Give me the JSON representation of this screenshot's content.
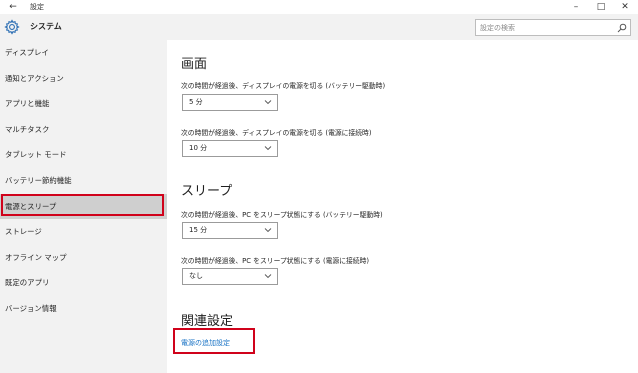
{
  "window": {
    "back_glyph": "←",
    "title": "設定",
    "minimize_glyph": "–",
    "maximize_glyph": "□",
    "close_glyph": "✕"
  },
  "header": {
    "icon": "gear-icon",
    "title": "システム",
    "search_placeholder": "設定の検索",
    "search_icon": "search-icon"
  },
  "sidebar": {
    "items": [
      {
        "label": "ディスプレイ",
        "active": false
      },
      {
        "label": "通知とアクション",
        "active": false
      },
      {
        "label": "アプリと機能",
        "active": false
      },
      {
        "label": "マルチタスク",
        "active": false
      },
      {
        "label": "タブレット モード",
        "active": false
      },
      {
        "label": "バッテリー節約機能",
        "active": false
      },
      {
        "label": "電源とスリープ",
        "active": true
      },
      {
        "label": "ストレージ",
        "active": false
      },
      {
        "label": "オフライン マップ",
        "active": false
      },
      {
        "label": "既定のアプリ",
        "active": false
      },
      {
        "label": "バージョン情報",
        "active": false
      }
    ]
  },
  "main": {
    "screen": {
      "heading": "画面",
      "battery_label": "次の時間が経過後、ディスプレイの電源を切る (バッテリー駆動時)",
      "battery_value": "5 分",
      "plugged_label": "次の時間が経過後、ディスプレイの電源を切る (電源に接続時)",
      "plugged_value": "10 分"
    },
    "sleep": {
      "heading": "スリープ",
      "battery_label": "次の時間が経過後、PC をスリープ状態にする (バッテリー駆動時)",
      "battery_value": "15 分",
      "plugged_label": "次の時間が経過後、PC をスリープ状態にする (電源に接続時)",
      "plugged_value": "なし"
    },
    "related": {
      "heading": "関連設定",
      "link": "電源の追加設定"
    }
  },
  "colors": {
    "accent_link": "#1a73c5",
    "highlight_box": "#d0021b",
    "sidebar_bg": "#f2f2f2",
    "active_item_bg": "#cfcfcf"
  }
}
